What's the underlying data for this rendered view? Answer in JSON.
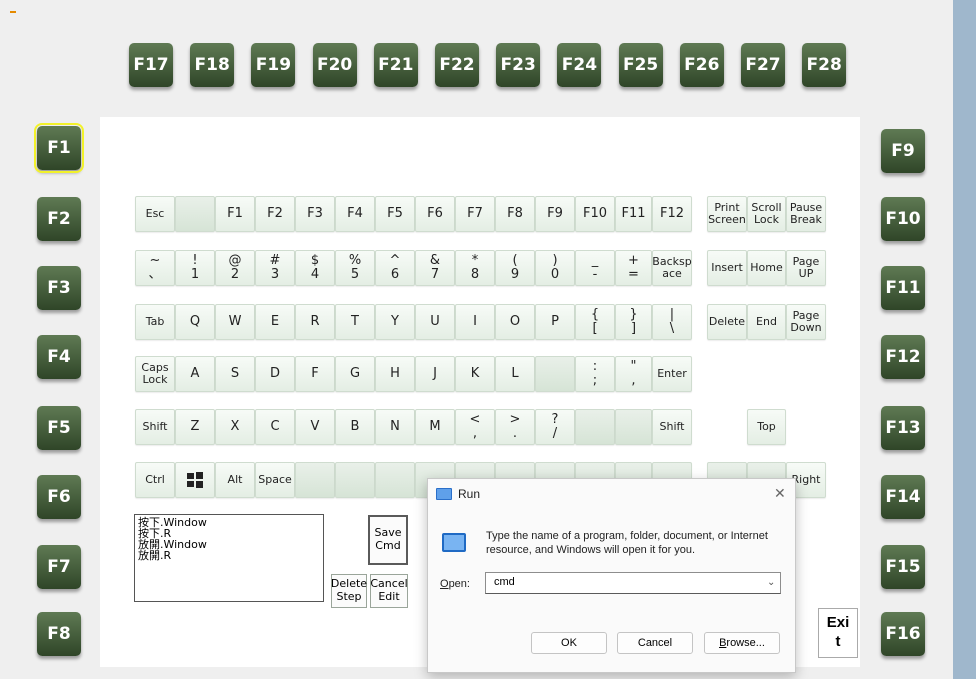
{
  "fkeys_top": [
    "F17",
    "F18",
    "F19",
    "F20",
    "F21",
    "F22",
    "F23",
    "F24",
    "F25",
    "F26",
    "F27",
    "F28"
  ],
  "fkeys_left": [
    "F1",
    "F2",
    "F3",
    "F4",
    "F5",
    "F6",
    "F7",
    "F8"
  ],
  "fkeys_right": [
    "F9",
    "F10",
    "F11",
    "F12",
    "F13",
    "F14",
    "F15",
    "F16"
  ],
  "keyboard": {
    "row1": [
      "Esc",
      "",
      "F1",
      "F2",
      "F3",
      "F4",
      "F5",
      "F6",
      "F7",
      "F8",
      "F9",
      "F10",
      "F11",
      "F12"
    ],
    "row2": [
      [
        "~",
        "、"
      ],
      [
        "!",
        "1"
      ],
      [
        "@",
        "2"
      ],
      [
        "#",
        "3"
      ],
      [
        "$",
        "4"
      ],
      [
        "%",
        "5"
      ],
      [
        "^",
        "6"
      ],
      [
        "&",
        "7"
      ],
      [
        "*",
        "8"
      ],
      [
        "(",
        "9"
      ],
      [
        ")",
        "0"
      ],
      [
        "_",
        "-"
      ],
      [
        "+",
        "="
      ],
      [
        "Backsp",
        "ace"
      ]
    ],
    "row3": [
      "Tab",
      "Q",
      "W",
      "E",
      "R",
      "T",
      "Y",
      "U",
      "I",
      "O",
      "P",
      [
        "{",
        "["
      ],
      [
        "}",
        "]"
      ],
      [
        "|",
        "\\"
      ]
    ],
    "row4": [
      [
        "Caps",
        "Lock"
      ],
      "A",
      "S",
      "D",
      "F",
      "G",
      "H",
      "J",
      "K",
      "L",
      "",
      [
        ":",
        ";"
      ],
      [
        "\"",
        ","
      ],
      "Enter"
    ],
    "row5": [
      "Shift",
      "Z",
      "X",
      "C",
      "V",
      "B",
      "N",
      "M",
      [
        "<",
        ","
      ],
      [
        ">",
        "."
      ],
      [
        "?",
        "/"
      ],
      "",
      "",
      "Shift"
    ],
    "row6": [
      "Ctrl",
      "win-logo-icon",
      "Alt",
      "Space"
    ],
    "nav1": [
      [
        "Print",
        "Screen"
      ],
      [
        "Scroll",
        "Lock"
      ],
      [
        "Pause",
        "Break"
      ]
    ],
    "nav2": [
      "Insert",
      "Home",
      [
        "Page",
        "UP"
      ]
    ],
    "nav3": [
      "Delete",
      "End",
      [
        "Page",
        "Down"
      ]
    ],
    "top": "Top",
    "right": "Right"
  },
  "log_lines": [
    "按下.Window",
    "按下.R",
    "放開.Window",
    "放開.R"
  ],
  "buttons": {
    "save_cmd": [
      "Save",
      "Cmd"
    ],
    "delete_step": [
      "Delete",
      "Step"
    ],
    "cancel_edit": [
      "Cancel",
      "Edit"
    ],
    "exit": [
      "Exi",
      "t"
    ]
  },
  "run_dialog": {
    "title": "Run",
    "close": "✕",
    "description": "Type the name of a program, folder, document, or Internet resource, and Windows will open it for you.",
    "open_label": "Open:",
    "open_value": "cmd",
    "ok": "OK",
    "cancel": "Cancel",
    "browse": "Browse..."
  },
  "colors": {
    "fkey": "#3f5a36",
    "panel": "#ffffff",
    "accent_strip": "#9fb7cc",
    "selected_outline": "#f2f22a"
  }
}
